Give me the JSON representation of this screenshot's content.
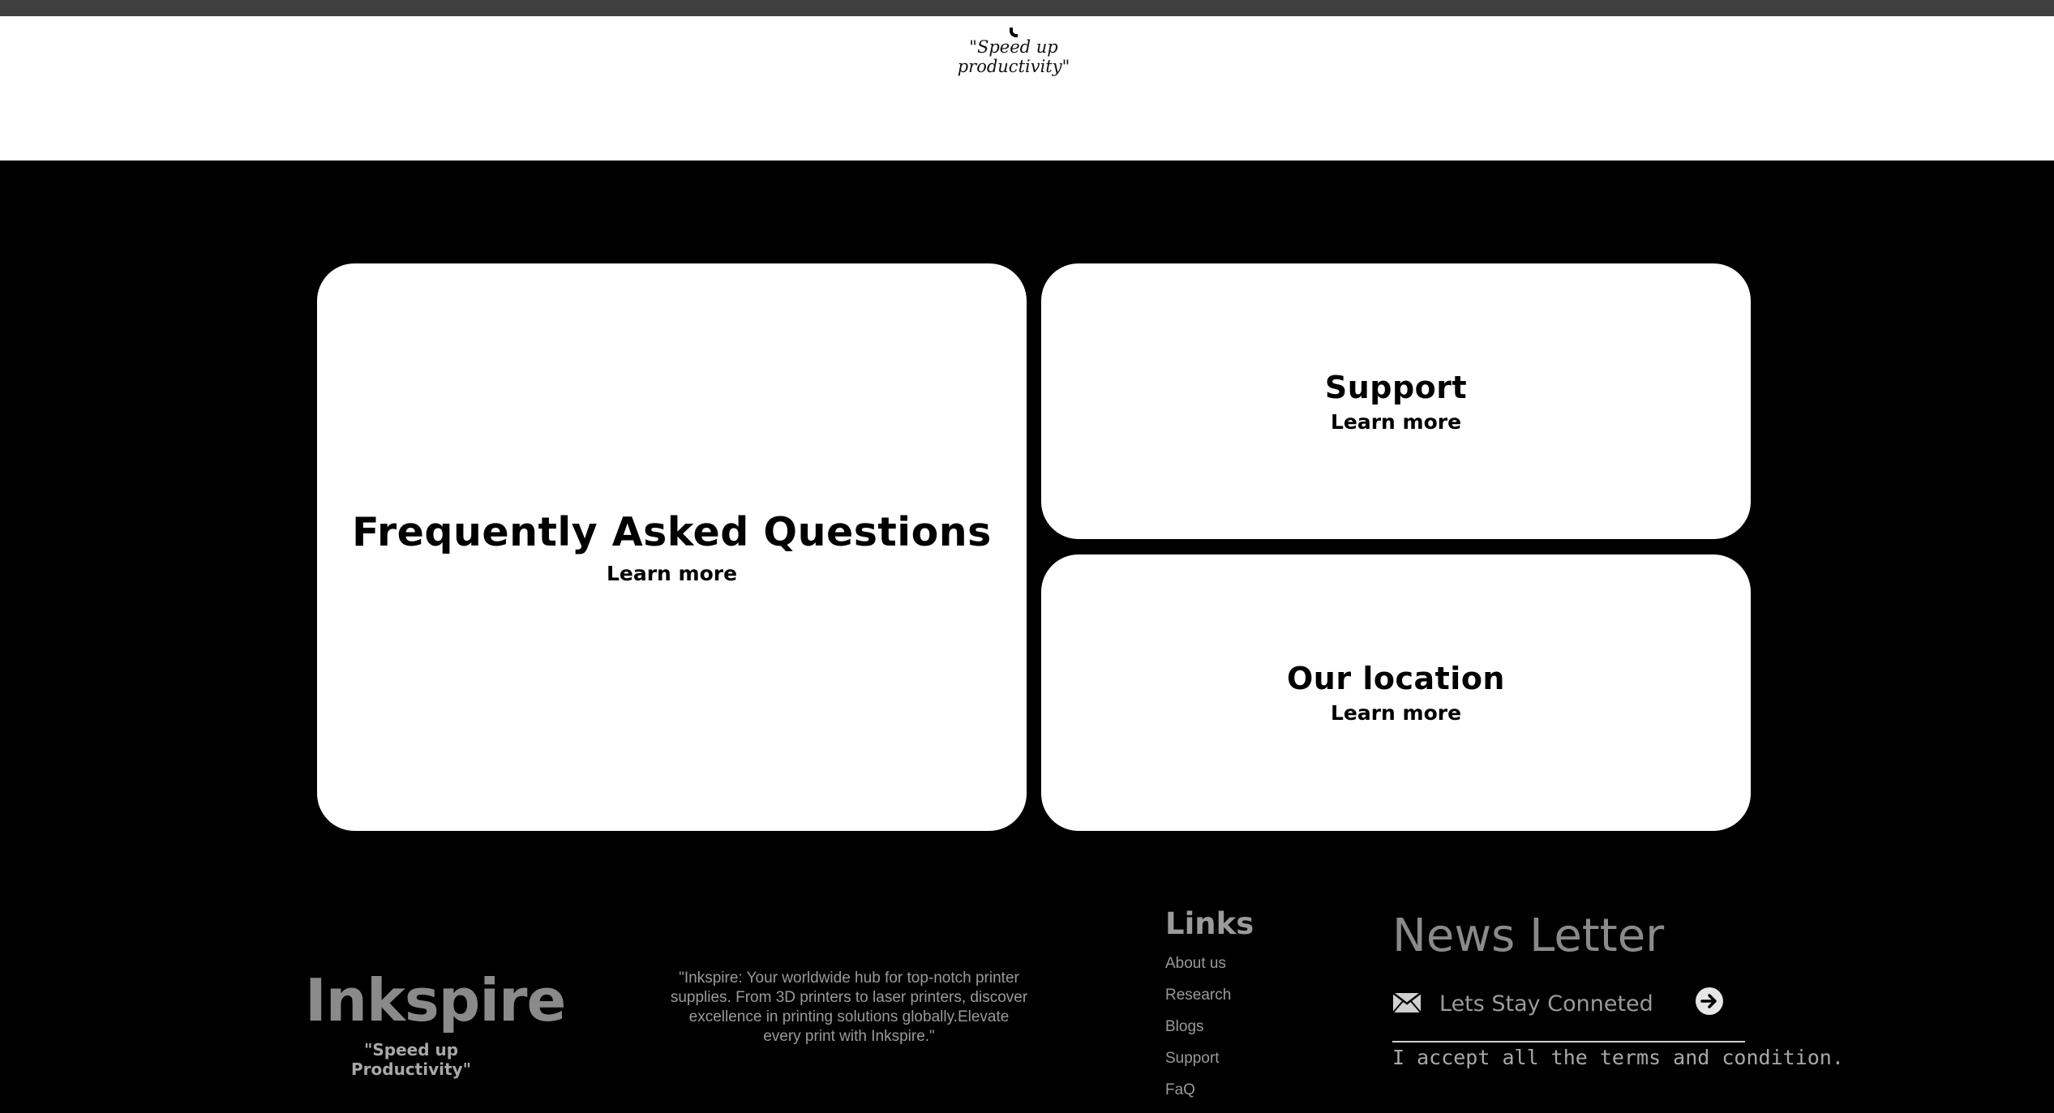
{
  "header": {
    "tagline": "\"Speed up productivity\""
  },
  "cards": {
    "faq": {
      "title": "Frequently Asked Questions",
      "link": "Learn more"
    },
    "support": {
      "title": "Support",
      "link": "Learn more"
    },
    "location": {
      "title": "Our location",
      "link": "Learn more"
    }
  },
  "footer": {
    "brand": "Inkspire",
    "brand_tagline": "\"Speed up Productivity\"",
    "blurb": "\"Inkspire: Your worldwide hub for top-notch printer supplies. From 3D printers to laser printers, discover excellence in printing solutions globally.Elevate every print with Inkspire.\"",
    "links": {
      "title": "Links",
      "items": [
        "About us",
        "Research",
        "Blogs",
        "Support",
        "FaQ"
      ]
    },
    "newsletter": {
      "title": "News Letter",
      "placeholder": "Lets Stay Conneted",
      "terms": "I accept all the terms and condition."
    }
  },
  "icons": {
    "mail": "mail-icon",
    "submit": "arrow-right-circle-icon"
  },
  "colors": {
    "page_background": "#000000",
    "card_background": "#ffffff",
    "footer_text": "#9a9a9a",
    "topbar": "#3f3f3f"
  }
}
